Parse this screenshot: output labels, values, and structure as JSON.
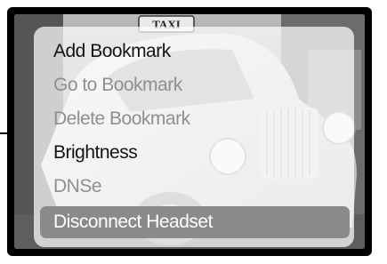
{
  "menu": {
    "items": [
      {
        "label": "Add Bookmark",
        "state": "enabled"
      },
      {
        "label": "Go to Bookmark",
        "state": "disabled"
      },
      {
        "label": "Delete Bookmark",
        "state": "disabled"
      },
      {
        "label": "Brightness",
        "state": "enabled"
      },
      {
        "label": "DNSe",
        "state": "disabled"
      },
      {
        "label": "Disconnect Headset",
        "state": "selected"
      }
    ]
  },
  "background": {
    "sign_text": "TAXI"
  },
  "colors": {
    "frame": "#000000",
    "enabled_text": "#141414",
    "disabled_text": "#8f8f8f",
    "selected_highlight": "#8a8a8a",
    "selected_text": "#ffffff"
  }
}
